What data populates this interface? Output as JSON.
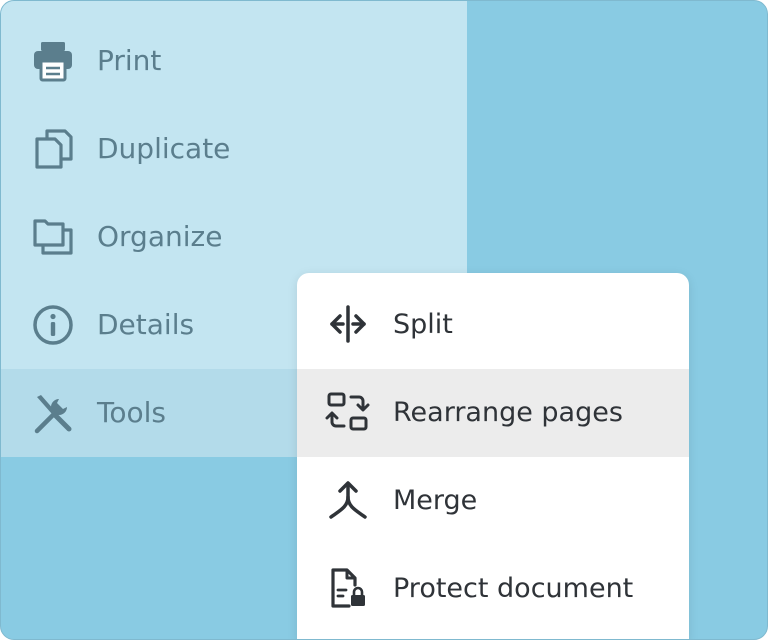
{
  "colors": {
    "background_blue": "#89cbe3",
    "side_menu": "#c3e5f1",
    "side_active": "#b3dbea",
    "side_text": "#5b7e8d",
    "popup_bg": "#ffffff",
    "popup_active": "#ececec",
    "popup_text": "#2f3338"
  },
  "side_menu": {
    "items": [
      {
        "label": "Print",
        "icon": "printer-icon"
      },
      {
        "label": "Duplicate",
        "icon": "copy-icon"
      },
      {
        "label": "Organize",
        "icon": "folders-icon"
      },
      {
        "label": "Details",
        "icon": "info-icon"
      },
      {
        "label": "Tools",
        "icon": "tools-icon",
        "active": true
      }
    ]
  },
  "tools_submenu": {
    "items": [
      {
        "label": "Split",
        "icon": "split-icon"
      },
      {
        "label": "Rearrange pages",
        "icon": "rearrange-icon",
        "active": true
      },
      {
        "label": "Merge",
        "icon": "merge-icon"
      },
      {
        "label": "Protect document",
        "icon": "lock-document-icon"
      }
    ]
  }
}
